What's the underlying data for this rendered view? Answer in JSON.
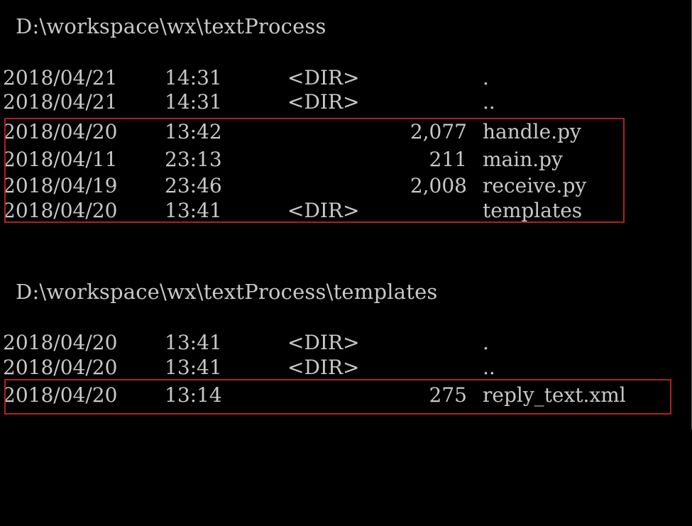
{
  "console": {
    "dir1": {
      "path": "D:\\workspace\\wx\\textProcess",
      "entries": [
        {
          "date": "2018/04/21",
          "time": "14:31",
          "dir": "<DIR>",
          "size": "",
          "name": "."
        },
        {
          "date": "2018/04/21",
          "time": "14:31",
          "dir": "<DIR>",
          "size": "",
          "name": ".."
        },
        {
          "date": "2018/04/20",
          "time": "13:42",
          "dir": "",
          "size": "2,077",
          "name": "handle.py"
        },
        {
          "date": "2018/04/11",
          "time": "23:13",
          "dir": "",
          "size": "211",
          "name": "main.py"
        },
        {
          "date": "2018/04/19",
          "time": "23:46",
          "dir": "",
          "size": "2,008",
          "name": "receive.py"
        },
        {
          "date": "2018/04/20",
          "time": "13:41",
          "dir": "<DIR>",
          "size": "",
          "name": "templates"
        }
      ]
    },
    "dir2": {
      "path": "D:\\workspace\\wx\\textProcess\\templates",
      "entries": [
        {
          "date": "2018/04/20",
          "time": "13:41",
          "dir": "<DIR>",
          "size": "",
          "name": "."
        },
        {
          "date": "2018/04/20",
          "time": "13:41",
          "dir": "<DIR>",
          "size": "",
          "name": ".."
        },
        {
          "date": "2018/04/20",
          "time": "13:14",
          "dir": "",
          "size": "275",
          "name": "reply_text.xml"
        }
      ]
    }
  },
  "colors": {
    "background": "#000000",
    "text": "#c8c8c8",
    "highlight": "#b02020"
  }
}
